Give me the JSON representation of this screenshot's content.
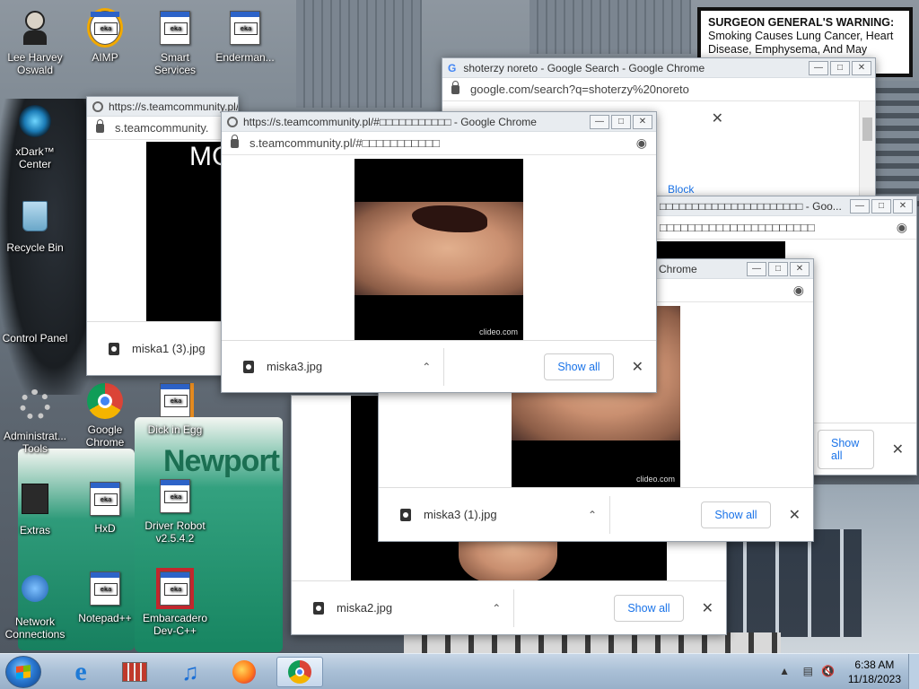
{
  "desktop": {
    "icons": [
      {
        "label": "Lee Harvey\nOswald",
        "icon": "person-icon"
      },
      {
        "label": "AIMP",
        "icon": "document-icon"
      },
      {
        "label": "Smart\nServices",
        "icon": "document-icon"
      },
      {
        "label": "Enderman...",
        "icon": "document-icon"
      },
      {
        "label": "xDark™\nCenter",
        "icon": "xdark-icon"
      },
      {
        "label": "Recycle Bin",
        "icon": "recycle-bin-icon"
      },
      {
        "label": "Control Panel",
        "icon": "control-panel-icon"
      },
      {
        "label": "Administrat...\nTools",
        "icon": "admin-tools-icon"
      },
      {
        "label": "Google\nChrome",
        "icon": "chrome-icon"
      },
      {
        "label": "Dick in Egg",
        "icon": "document-icon"
      },
      {
        "label": "Extras",
        "icon": "folder-icon"
      },
      {
        "label": "HxD",
        "icon": "document-icon"
      },
      {
        "label": "Driver Robot\nv2.5.4.2",
        "icon": "document-icon"
      },
      {
        "label": "Network\nConnections",
        "icon": "network-icon"
      },
      {
        "label": "Notepad++",
        "icon": "document-icon"
      },
      {
        "label": "Embarcadero\nDev-C++",
        "icon": "document-icon"
      }
    ],
    "warning": {
      "heading": "SURGEON GENERAL'S WARNING:",
      "text": "Smoking Causes Lung Cancer, Heart Disease, Emphysema, And May Complicate Pregnancy."
    },
    "newport": "Newport"
  },
  "windows": {
    "search": {
      "title": "shoterzy noreto - Google Search - Google Chrome",
      "url": "google.com/search?q=shoterzy%20noreto",
      "block": "Block"
    },
    "w1": {
      "title": "https://s.teamcommunity.pl/#",
      "url": "s.teamcommunity.",
      "file": "miska1 (3).jpg"
    },
    "w2": {
      "title": "https://s.teamcommunity.pl/#□□□□□□□□□□□ - Google Chrome",
      "url": "s.teamcommunity.pl/#□□□□□□□□□□□",
      "file": "miska3.jpg",
      "show_all": "Show all",
      "watermark": "clideo.com"
    },
    "w3": {
      "title": "□□□□□□□□□□□□□□□□□□□□□□ - Goo...",
      "url": "□□□□□□□□□□□□□□□□□□□□□□",
      "show_all": "Show all"
    },
    "w4": {
      "title": "Chrome",
      "file": "miska3 (1).jpg",
      "show_all": "Show all",
      "watermark": "clideo.com"
    },
    "w5": {
      "file": "miska2.jpg",
      "show_all": "Show all"
    }
  },
  "taskbar": {
    "time": "6:38 AM",
    "date": "11/18/2023"
  }
}
